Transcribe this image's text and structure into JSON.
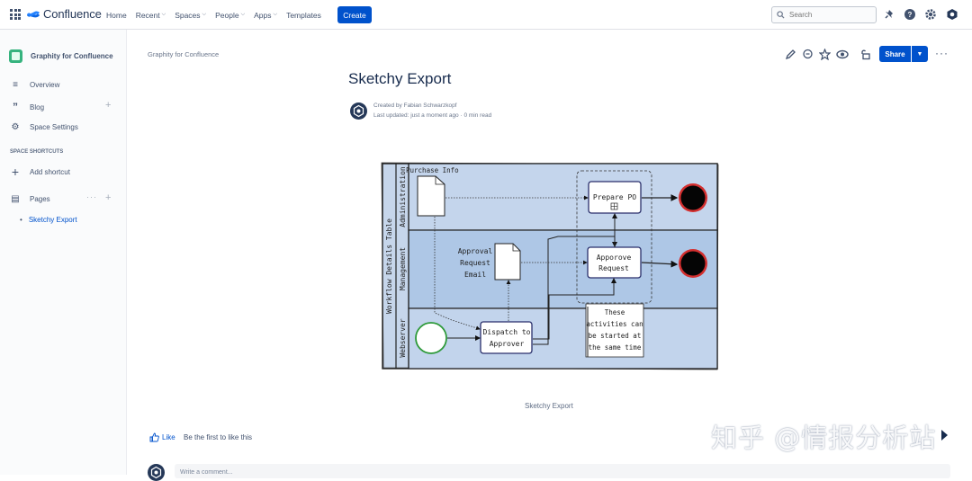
{
  "nav": {
    "app_name": "Confluence",
    "items": [
      {
        "label": "Home",
        "chevron": false
      },
      {
        "label": "Recent",
        "chevron": true
      },
      {
        "label": "Spaces",
        "chevron": true
      },
      {
        "label": "People",
        "chevron": true
      },
      {
        "label": "Apps",
        "chevron": true
      },
      {
        "label": "Templates",
        "chevron": false
      }
    ],
    "create_label": "Create",
    "search_placeholder": "Search"
  },
  "sidebar": {
    "space_name": "Graphity for Confluence",
    "overview": "Overview",
    "blog": "Blog",
    "space_settings": "Space Settings",
    "shortcuts_heading": "SPACE SHORTCUTS",
    "add_shortcut": "Add shortcut",
    "pages": "Pages",
    "current_page": "Sketchy Export"
  },
  "page": {
    "breadcrumb": "Graphity for Confluence",
    "title": "Sketchy Export",
    "created_by": "Created by Fabian Schwarzkopf",
    "last_updated": "Last updated: just a moment ago",
    "read_time": "0 min read",
    "share_label": "Share",
    "caption": "Sketchy Export",
    "like_label": "Like",
    "like_hint": "Be the first to like this",
    "comment_placeholder": "Write a comment..."
  },
  "diagram": {
    "table_title": "Workflow Details Table",
    "lanes": [
      "Administration",
      "Management",
      "Webserver"
    ],
    "purchase_info": "Purchase Info",
    "prepare_po": "Prepare PO",
    "approval_email": [
      "Approval",
      "Request",
      "Email"
    ],
    "approve_request": [
      "Apporove",
      "Request"
    ],
    "dispatch": [
      "Dispatch to",
      "Approver"
    ],
    "note": [
      "These",
      "activities can",
      "be started at",
      "the same time"
    ],
    "colors": {
      "lane_fill": "#c5d5ea",
      "lane_dark": "#a9c2e2",
      "end_ring": "#d32f2f",
      "start_ring": "#2e9a3a"
    }
  },
  "watermark": "知乎 @情报分析站"
}
